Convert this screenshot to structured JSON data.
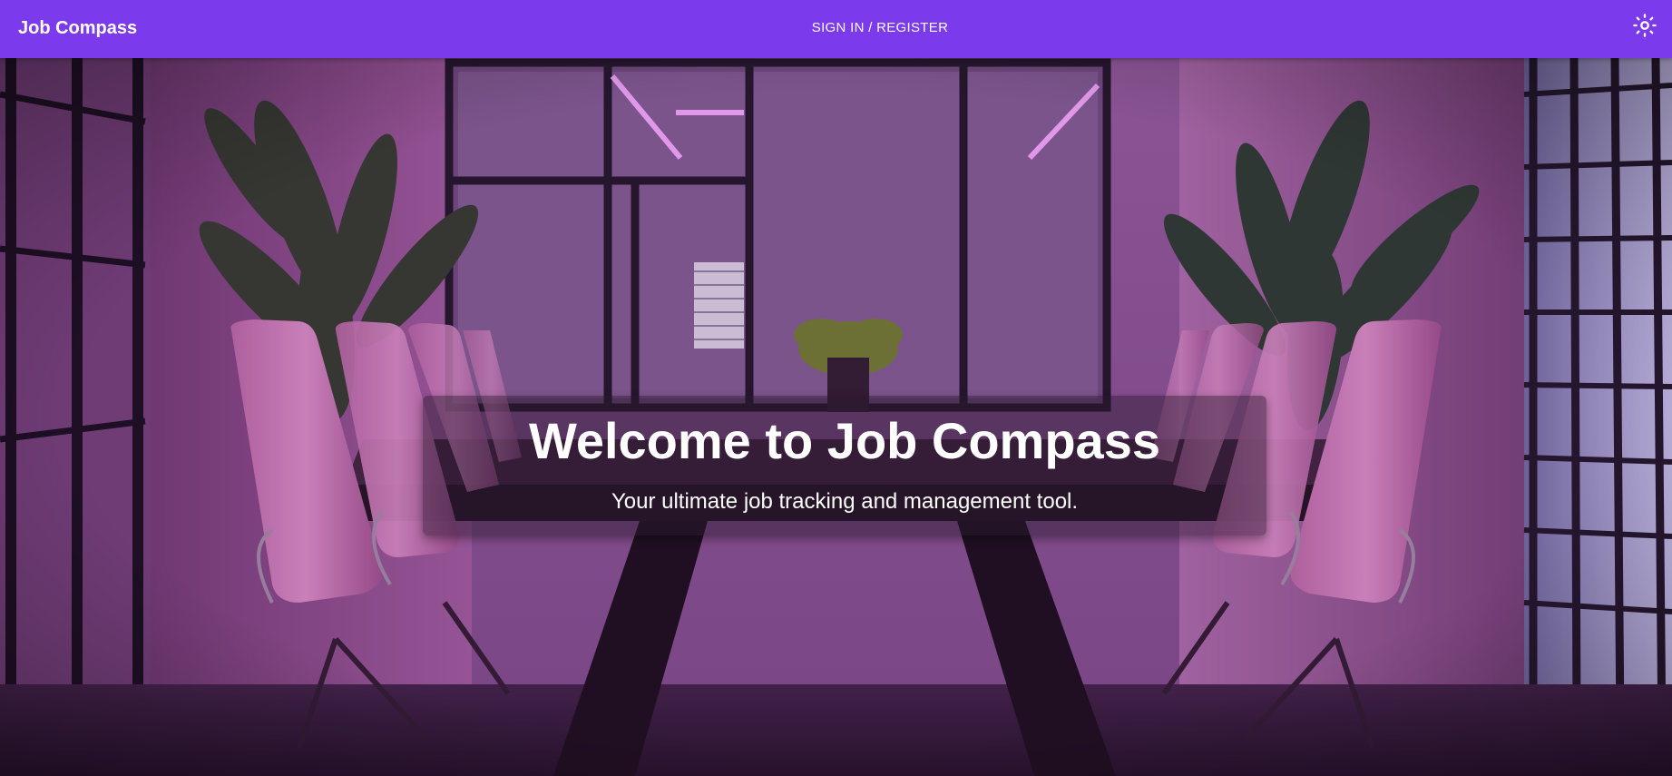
{
  "header": {
    "brand": "Job Compass",
    "nav_link": "SIGN IN / REGISTER",
    "theme_icon": "sun-icon"
  },
  "hero": {
    "background_image": "conference-room-photo",
    "title": "Welcome to Job Compass",
    "subtitle": "Your ultimate job tracking and management tool."
  },
  "colors": {
    "appbar": "#7c3aed",
    "text": "#ffffff"
  }
}
